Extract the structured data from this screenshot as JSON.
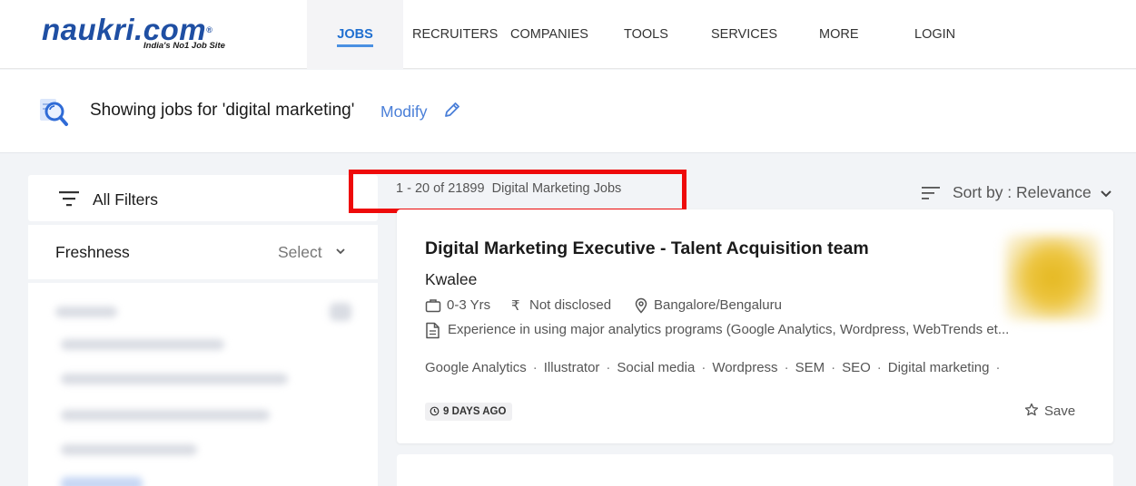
{
  "header": {
    "logo_text": "naukri",
    "logo_suffix": ".com",
    "logo_tagline": "India's No1 Job Site",
    "nav": [
      {
        "label": "JOBS",
        "active": true
      },
      {
        "label": "RECRUITERS"
      },
      {
        "label": "COMPANIES"
      },
      {
        "label": "TOOLS"
      },
      {
        "label": "SERVICES"
      },
      {
        "label": "MORE"
      },
      {
        "label": "LOGIN"
      }
    ]
  },
  "search_banner": {
    "text": "Showing jobs for 'digital marketing'",
    "modify_label": "Modify"
  },
  "filters": {
    "all_filters_label": "All Filters",
    "freshness_label": "Freshness",
    "freshness_value": "Select"
  },
  "results": {
    "count_text": "1 - 20 of 21899",
    "count_suffix": "Digital Marketing Jobs",
    "sort_label": "Sort by : Relevance"
  },
  "jobs": [
    {
      "title": "Digital Marketing Executive - Talent Acquisition team",
      "company": "Kwalee",
      "experience": "0-3 Yrs",
      "salary": "Not disclosed",
      "location": "Bangalore/Bengaluru",
      "description": "Experience in using major analytics programs (Google Analytics, Wordpress, WebTrends et...",
      "tags": [
        "Google Analytics",
        "Illustrator",
        "Social media",
        "Wordpress",
        "SEM",
        "SEO",
        "Digital marketing"
      ],
      "posted": "9 DAYS AGO",
      "save_label": "Save"
    }
  ],
  "colors": {
    "brand_blue": "#1f4fa3",
    "active_nav": "#1f6fd0",
    "link_blue": "#4a7fd8",
    "highlight_red": "#ee0a0a"
  }
}
